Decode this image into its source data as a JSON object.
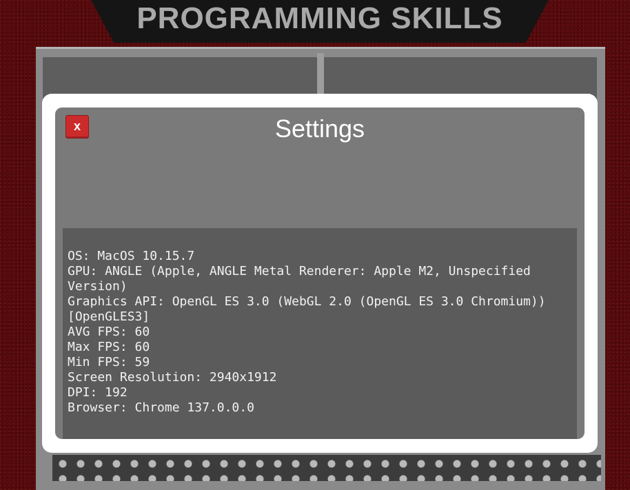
{
  "header": {
    "title": "PROGRAMMING SKILLS"
  },
  "settings_dialog": {
    "title": "Settings",
    "close_label": "x",
    "info_lines": [
      "OS: MacOS 10.15.7",
      "GPU: ANGLE (Apple, ANGLE Metal Renderer: Apple M2, Unspecified Version)",
      "Graphics API: OpenGL ES 3.0 (WebGL 2.0 (OpenGL ES 3.0 Chromium)) [OpenGLES3]",
      "AVG FPS: 60",
      "Max FPS: 60",
      "Min FPS: 59",
      "Screen Resolution: 2940x1912",
      "DPI: 192",
      "Browser: Chrome 137.0.0.0"
    ]
  },
  "colors": {
    "background": "#5a0a0c",
    "close_button": "#cc2b2b",
    "dialog_panel": "#7a7a7a",
    "info_box": "#5b5b5b"
  }
}
